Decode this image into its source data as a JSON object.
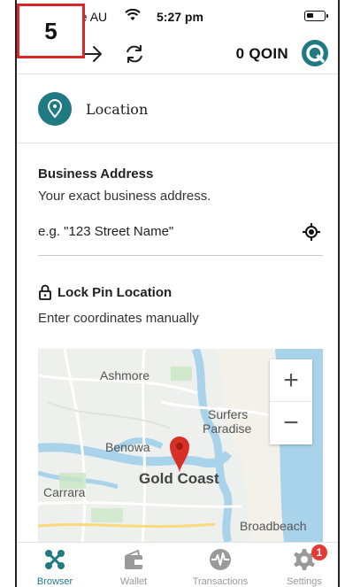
{
  "step_badge": "5",
  "status_bar": {
    "carrier": "ne AU",
    "time": "5:27 pm"
  },
  "header": {
    "balance": "0 QOIN"
  },
  "section": {
    "title": "Location"
  },
  "address": {
    "label": "Business Address",
    "hint": "Your exact business address.",
    "placeholder": "e.g. \"123 Street Name\""
  },
  "lock": {
    "label": "Lock Pin Location",
    "hint": "Enter coordinates manually"
  },
  "map": {
    "labels": {
      "ashmore": "Ashmore",
      "surfers": "Surfers",
      "paradise": "Paradise",
      "benowa": "Benowa",
      "gold_coast": "Gold Coast",
      "carrara": "Carrara",
      "broadbeach": "Broadbeach"
    },
    "zoom_in": "+",
    "zoom_out": "−"
  },
  "tabs": [
    {
      "label": "Browser",
      "icon": "browser-icon",
      "active": true
    },
    {
      "label": "Wallet",
      "icon": "wallet-icon"
    },
    {
      "label": "Transactions",
      "icon": "transactions-icon"
    },
    {
      "label": "Settings",
      "icon": "settings-icon",
      "badge": "1"
    }
  ],
  "colors": {
    "teal": "#1f7a83",
    "pin_red": "#d93025",
    "badge_red": "#e53935",
    "annotation_red": "#d62828"
  }
}
